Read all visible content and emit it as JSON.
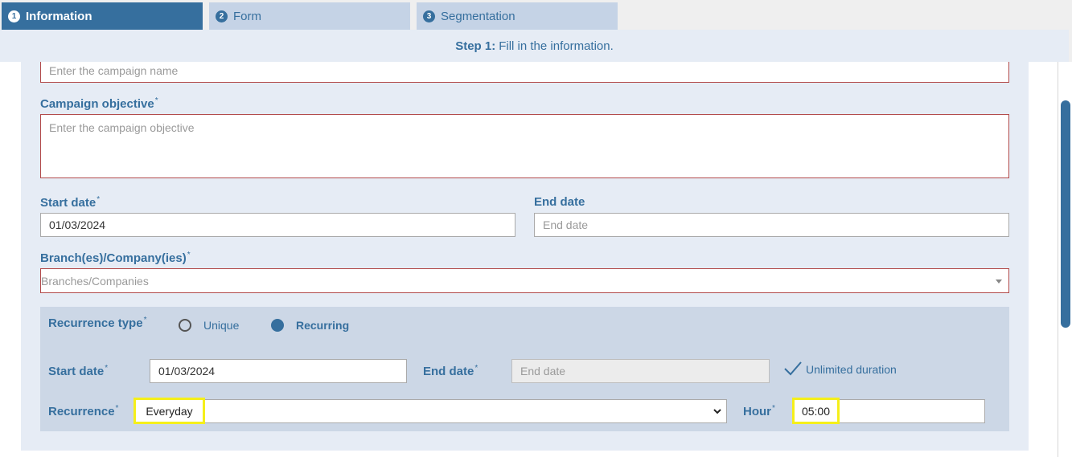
{
  "tabs": [
    {
      "num": "1",
      "label": "Information"
    },
    {
      "num": "2",
      "label": "Form"
    },
    {
      "num": "3",
      "label": "Segmentation"
    }
  ],
  "step": {
    "prefix": "Step 1:",
    "text": "Fill in the information."
  },
  "form": {
    "campaign_name": {
      "placeholder": "Enter the campaign name"
    },
    "campaign_objective": {
      "label": "Campaign objective",
      "placeholder": "Enter the campaign objective"
    },
    "start_date": {
      "label": "Start date",
      "value": "01/03/2024"
    },
    "end_date": {
      "label": "End date",
      "placeholder": "End date"
    },
    "branches": {
      "label": "Branch(es)/Company(ies)",
      "placeholder": "Branches/Companies"
    }
  },
  "recurrence": {
    "type_label": "Recurrence type",
    "options": [
      "Unique",
      "Recurring"
    ],
    "selected": "Recurring",
    "start_label": "Start date",
    "start_value": "01/03/2024",
    "end_label": "End date",
    "end_placeholder": "End date",
    "unlimited_label": "Unlimited duration",
    "recurrence_label": "Recurrence",
    "recurrence_value": "Everyday",
    "hour_label": "Hour",
    "hour_value": "05:00"
  },
  "required_marker": "*",
  "colors": {
    "accent": "#366f9e",
    "error_border": "#b24a4a",
    "highlight": "#f5ef1a",
    "panel": "#e6ecf5"
  }
}
